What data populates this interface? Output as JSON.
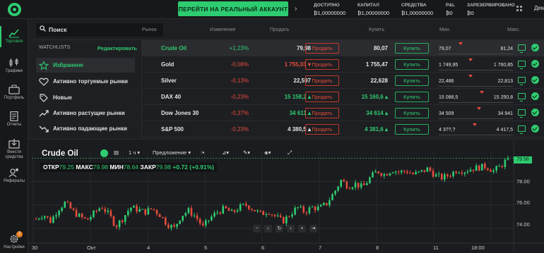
{
  "topbar": {
    "real_account_button": "ПЕРЕЙТИ НА РЕАЛЬНЫЙ АККАУНТ",
    "stats": [
      {
        "label": "ДОСТУПНО",
        "value": "₿1,00000000"
      },
      {
        "label": "КАПИТАЛ",
        "value": "₿1,00000000"
      },
      {
        "label": "СРЕДСТВА",
        "value": "₿1,00000000"
      },
      {
        "label": "P&L",
        "value": "₿0"
      },
      {
        "label": "ЗАРЕЗЕРВИРОВАНО",
        "value": "₿0"
      }
    ],
    "demo_label": "Дем"
  },
  "nav": [
    {
      "label": "Торговля",
      "icon": "chart-line-icon",
      "active": true
    },
    {
      "label": "Графики",
      "icon": "candles-icon"
    },
    {
      "label": "Портфель",
      "icon": "briefcase-icon"
    },
    {
      "label": "Отчеты",
      "icon": "document-icon"
    },
    {
      "label": "Внести средства",
      "icon": "deposit-icon"
    },
    {
      "label": "Рефералы",
      "icon": "users-icon"
    },
    {
      "label": "Настройки",
      "icon": "gear-icon",
      "badge": "2"
    }
  ],
  "search": {
    "placeholder": "Поиск"
  },
  "columns": {
    "market": "Рынок",
    "change": "Изменение",
    "sell": "Продать",
    "buy": "Купить",
    "min": "Мин.",
    "max": "Макс."
  },
  "watchlists": {
    "title": "WATCHLISTS",
    "edit": "Редактировать",
    "items": [
      {
        "label": "Избранное",
        "icon": "star-icon",
        "active": true
      },
      {
        "label": "Активно торгуемые рынки",
        "icon": "heart-icon"
      },
      {
        "label": "Новые",
        "icon": "tag-icon"
      },
      {
        "label": "Активно растущие рынки",
        "icon": "trend-up-icon"
      },
      {
        "label": "Активно падающие рынки",
        "icon": "trend-down-icon"
      }
    ]
  },
  "markets": [
    {
      "name": "Crude Oil",
      "change": "+1,23%",
      "dir": "pos",
      "sell": "79,98",
      "sell_color": "wht",
      "buy": "80,07",
      "buy_color": "wht",
      "min": "79,07",
      "max": "81,24",
      "selected": true,
      "sell_label": "Продать",
      "buy_label": "Купить"
    },
    {
      "name": "Gold",
      "change": "-0,08%",
      "dir": "neg",
      "sell": "1 755,03 ▾",
      "sell_color": "neg",
      "buy": "1 755,47",
      "buy_color": "wht",
      "min": "1 749,95",
      "max": "1 760,85",
      "sell_label": "Продать",
      "buy_label": "Купить"
    },
    {
      "name": "Silver",
      "change": "-0,13%",
      "dir": "neg",
      "sell": "22,597",
      "sell_color": "wht",
      "buy": "22,628",
      "buy_color": "wht",
      "min": "22,486",
      "max": "22,813",
      "sell_label": "Продать",
      "buy_label": "Купить"
    },
    {
      "name": "DAX 40",
      "change": "-0,23%",
      "dir": "neg",
      "sell": "15 158,2 ▴",
      "sell_color": "pos",
      "buy": "15 160,6 ▴",
      "buy_color": "pos",
      "min": "15 088,5",
      "max": "15 250,8",
      "sell_label": "Продать",
      "buy_label": "Купить"
    },
    {
      "name": "Dow Jones 30",
      "change": "-0,37%",
      "dir": "neg",
      "sell": "34 611 ▴",
      "sell_color": "pos",
      "buy": "34 614 ▴",
      "buy_color": "pos",
      "min": "34 509",
      "max": "34 941",
      "sell_label": "Продать",
      "buy_label": "Купить"
    },
    {
      "name": "S&P 500",
      "change": "-0,23%",
      "dir": "neg",
      "sell": "4 380,5 ▴",
      "sell_color": "wht",
      "buy": "4 381,6 ▴",
      "buy_color": "pos",
      "min": "4 3??,?",
      "max": "4 417,5",
      "sell_label": "Продать",
      "buy_label": "Купить"
    }
  ],
  "chart": {
    "title": "Crude Oil",
    "timeframe": "1 ч",
    "offer": "Предложение",
    "ohlc": {
      "o_label": "ОТКР",
      "o": "79.25",
      "h_label": "МАКС",
      "h": "79.98",
      "l_label": "МИН",
      "l": "78.64",
      "c_label": "ЗАКР",
      "c": "79.98",
      "chg": "+0.72 (+0.91%)"
    },
    "last_price": "79.98",
    "y_ticks": [
      "78.00",
      "76.00",
      "74.00"
    ],
    "x_ticks": [
      "30",
      "Окт",
      "4",
      "5",
      "6",
      "7",
      "8",
      "11",
      "18:00"
    ]
  },
  "chart_data": {
    "type": "candlestick",
    "ylim": [
      72.8,
      80.5
    ],
    "x_labels": [
      "30",
      "Окт",
      "4",
      "5",
      "6",
      "7",
      "8",
      "11",
      "18:00"
    ],
    "close_path": [
      74.8,
      75.2,
      74.6,
      75.6,
      76.2,
      75.5,
      75.0,
      74.7,
      75.3,
      75.9,
      75.2,
      74.2,
      74.9,
      75.8,
      75.6,
      75.4,
      75.7,
      75.2,
      74.4,
      74.0,
      75.1,
      75.5,
      75.0,
      74.1,
      74.9,
      75.4,
      75.7,
      75.3,
      75.8,
      76.0,
      75.6,
      75.2,
      75.5,
      75.0,
      74.6,
      75.2,
      75.8,
      75.4,
      75.8,
      75.7,
      76.1,
      77.0,
      78.1,
      77.6,
      77.8,
      77.5,
      78.3,
      78.9,
      78.6,
      79.0,
      78.8,
      78.9,
      78.6,
      78.8,
      79.1,
      78.5,
      78.3,
      78.6,
      79.0,
      78.9,
      79.1,
      79.2,
      79.3,
      78.9,
      79.3,
      79.98
    ]
  }
}
